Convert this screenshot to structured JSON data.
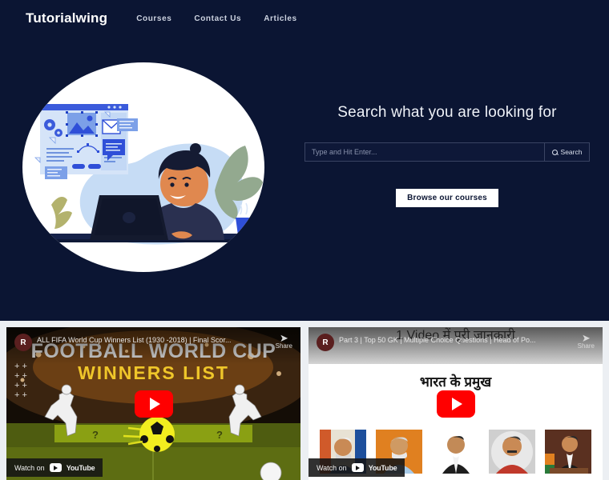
{
  "colors": {
    "navy": "#0b1533",
    "page_bg": "#eceff3",
    "accent_blue": "#2f4fd8",
    "youtube_red": "#ff0000",
    "white": "#ffffff"
  },
  "navbar": {
    "brand": "Tutorialwing",
    "links": [
      {
        "label": "Courses",
        "name": "nav-link-courses"
      },
      {
        "label": "Contact Us",
        "name": "nav-link-contact-us"
      },
      {
        "label": "Articles",
        "name": "nav-link-articles"
      }
    ]
  },
  "hero": {
    "illustration_alt": "person-at-laptop-illustration",
    "title": "Search what you are looking for",
    "search": {
      "placeholder": "Type and Hit Enter...",
      "value": "",
      "button_label": "Search",
      "icon": "search-icon"
    },
    "browse_button": "Browse our courses"
  },
  "videos": [
    {
      "name": "video-card-fifa",
      "avatar_initial": "R",
      "title": "ALL FIFA World Cup Winners List (1930 -2018) | Final Scor...",
      "share_label": "Share",
      "watch_on_label": "Watch on",
      "platform": "YouTube",
      "thumbnail_heading": "FOOTBALL WORLD CUP",
      "thumbnail_subheading": "WINNERS LIST",
      "play_icon": "play-icon"
    },
    {
      "name": "video-card-gk",
      "avatar_initial": "R",
      "title": "Part 3 | Top 50 GK | Multiple Choice Questions | Head of Po...",
      "share_label": "Share",
      "watch_on_label": "Watch on",
      "platform": "YouTube",
      "thumbnail_heading": "1 Video में पूरी जानकारी",
      "thumbnail_subheading": "भारत के प्रमुख",
      "play_icon": "play-icon"
    }
  ]
}
